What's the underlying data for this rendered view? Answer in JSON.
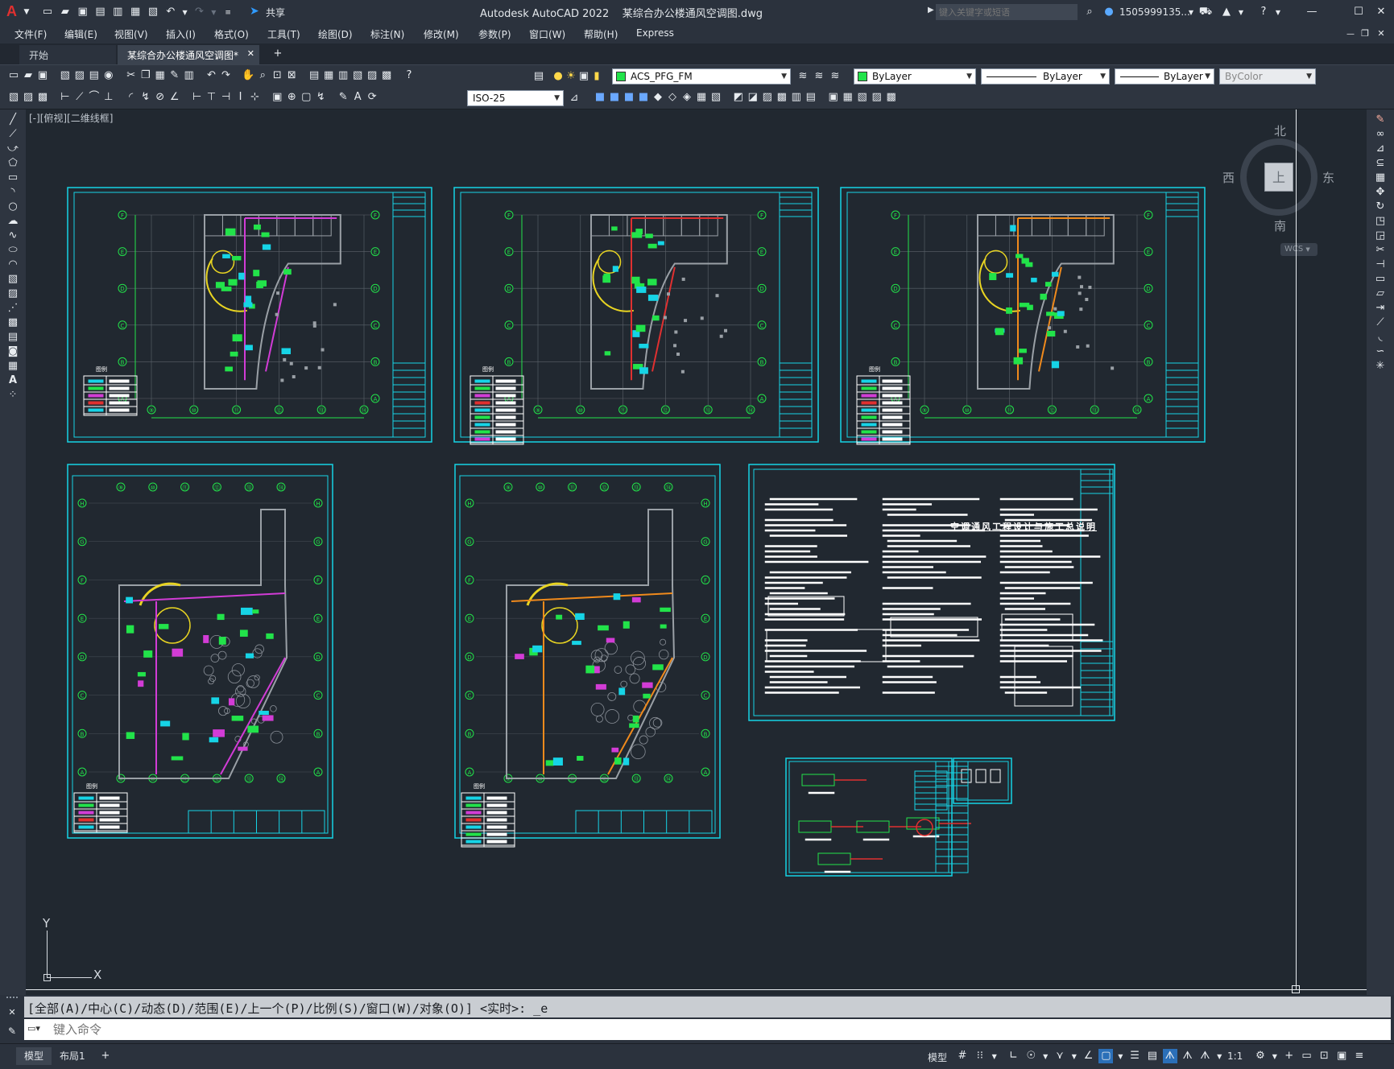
{
  "app": {
    "title": "Autodesk AutoCAD 2022",
    "filename": "某综合办公楼通风空调图.dwg",
    "share_label": "共享",
    "search_placeholder": "键入关键字或短语",
    "user": "1505999135...",
    "logo_letter": "A"
  },
  "menu": [
    "文件(F)",
    "编辑(E)",
    "视图(V)",
    "插入(I)",
    "格式(O)",
    "工具(T)",
    "绘图(D)",
    "标注(N)",
    "修改(M)",
    "参数(P)",
    "窗口(W)",
    "帮助(H)",
    "Express"
  ],
  "tabs": [
    {
      "label": "开始",
      "active": false
    },
    {
      "label": "某综合办公楼通风空调图*",
      "active": true
    }
  ],
  "toolbar": {
    "layer": "ACS_PFG_FM",
    "color": "ByLayer",
    "linetype": "ByLayer",
    "lineweight": "ByLayer",
    "plotstyle": "ByColor",
    "dimstyle": "ISO-25"
  },
  "viewport_label": "[-][俯视][二维线框]",
  "viewcube": {
    "north": "北",
    "south": "南",
    "east": "东",
    "west": "西",
    "face": "上",
    "wcs": "WCS"
  },
  "ucs": {
    "x": "X",
    "y": "Y"
  },
  "sheets": {
    "notes_title": "空调通风工程设计与施工总说明",
    "axis_labels_row": [
      "⑨",
      "⑩",
      "⑪",
      "⑫",
      "⑬",
      "⑭"
    ],
    "axis_labels_col": [
      "F",
      "E",
      "D",
      "C",
      "B",
      "A"
    ],
    "legend_label": "图例"
  },
  "command": {
    "history": "[全部(A)/中心(C)/动态(D)/范围(E)/上一个(P)/比例(S)/窗口(W)/对象(O)] <实时>: _e",
    "placeholder": "键入命令"
  },
  "status": {
    "tabs": [
      "模型",
      "布局1"
    ],
    "model_label": "模型",
    "scale": "1:1"
  },
  "colors": {
    "cyan": "#16d4e6",
    "green": "#22e34a",
    "yellow": "#e8d422",
    "magenta": "#d23cd6",
    "red": "#e03030",
    "orange": "#f08a1c",
    "wall": "#9aa0a6",
    "accent": "#1f8fe8"
  }
}
